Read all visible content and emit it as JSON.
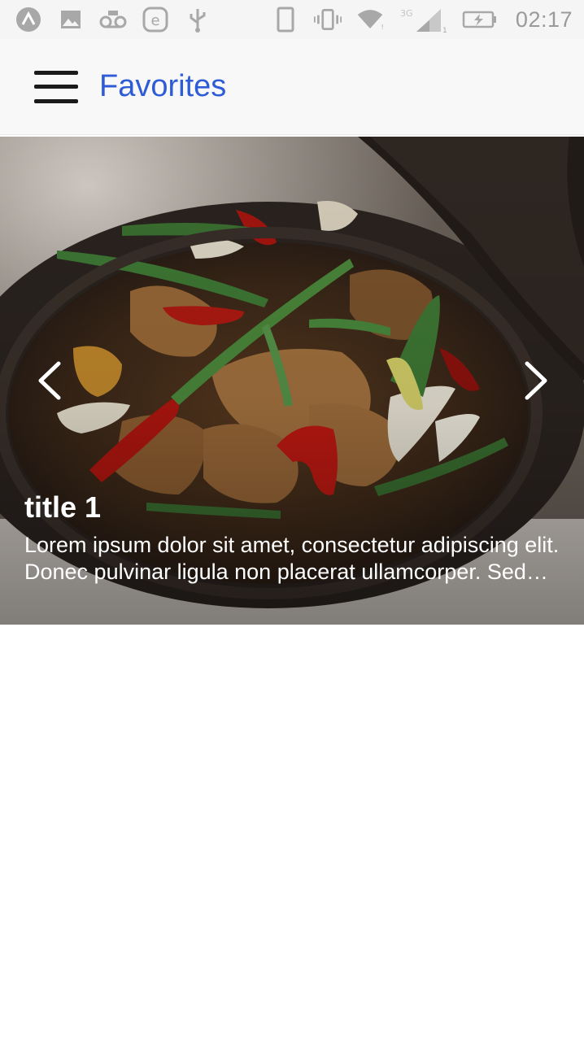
{
  "status_bar": {
    "time": "02:17",
    "left_icons": [
      "app-a-icon",
      "image-icon",
      "voicemail-icon",
      "e-icon",
      "usb-icon"
    ],
    "right_icons": [
      "phone-icon",
      "vibrate-icon",
      "wifi-icon",
      "network-3g-icon",
      "signal-icon",
      "battery-charging-icon"
    ],
    "network_label": "3G"
  },
  "app_bar": {
    "title": "Favorites",
    "title_color": "#2e5bd6"
  },
  "carousel": {
    "slide": {
      "title": "title 1",
      "text": "Lorem ipsum dolor sit amet, consectetur adipiscing elit. Donec pulvinar ligula non placerat ullamcorper. Sed sagittis sem at metus tristique, sit amet aliquet ipsum dignissim."
    },
    "prev_icon": "chevron-left-icon",
    "next_icon": "chevron-right-icon"
  }
}
